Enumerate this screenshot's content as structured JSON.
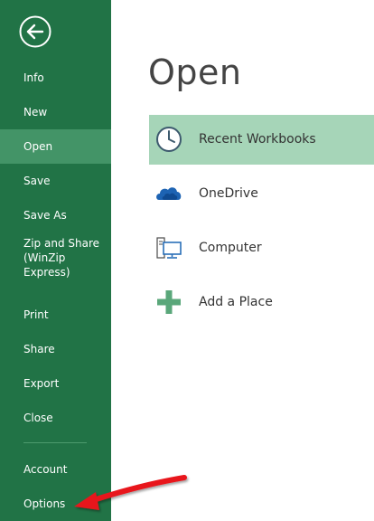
{
  "sidebar": {
    "items": [
      {
        "label": "Info"
      },
      {
        "label": "New"
      },
      {
        "label": "Open"
      },
      {
        "label": "Save"
      },
      {
        "label": "Save As"
      },
      {
        "label_lines": [
          "Zip and Share",
          "(WinZip",
          "Express)"
        ]
      },
      {
        "label": "Print"
      },
      {
        "label": "Share"
      },
      {
        "label": "Export"
      },
      {
        "label": "Close"
      }
    ],
    "bottom_items": [
      {
        "label": "Account"
      },
      {
        "label": "Options"
      }
    ]
  },
  "main": {
    "title": "Open",
    "places": [
      {
        "label": "Recent Workbooks",
        "icon": "clock-icon"
      },
      {
        "label": "OneDrive",
        "icon": "cloud-icon"
      },
      {
        "label": "Computer",
        "icon": "computer-icon"
      },
      {
        "label": "Add a Place",
        "icon": "plus-icon"
      }
    ]
  },
  "colors": {
    "sidebar_bg": "#217346",
    "sidebar_active": "#439467",
    "selected_place": "#a6d5b8",
    "annotation": "#e8141b"
  }
}
